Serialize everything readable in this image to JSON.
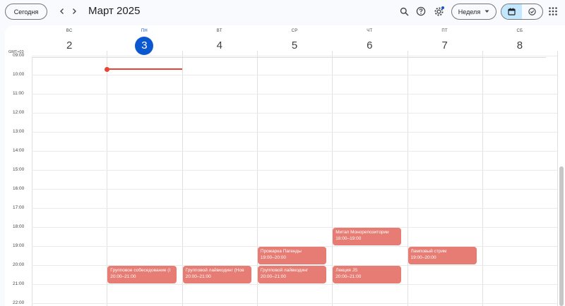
{
  "toolbar": {
    "today_label": "Сегодня",
    "prev_icon": "chevron-left-icon",
    "next_icon": "chevron-right-icon",
    "title": "Март 2025",
    "view_label": "Неделя",
    "accent": "#0b57d0"
  },
  "calendar": {
    "timezone": "GMT+03",
    "days": [
      {
        "dow": "ВС",
        "num": "2"
      },
      {
        "dow": "ПН",
        "num": "3",
        "today": true
      },
      {
        "dow": "ВТ",
        "num": "4"
      },
      {
        "dow": "СР",
        "num": "5"
      },
      {
        "dow": "ЧТ",
        "num": "6"
      },
      {
        "dow": "ПТ",
        "num": "7"
      },
      {
        "dow": "СБ",
        "num": "8"
      }
    ],
    "hours": [
      "09:00",
      "10:00",
      "11:00",
      "12:00",
      "13:00",
      "14:00",
      "15:00",
      "16:00",
      "17:00",
      "18:00",
      "19:00",
      "20:00",
      "21:00",
      "22:00"
    ],
    "events": [
      {
        "day": 1,
        "title": "Групповое собеседование (I",
        "time": "20:00–21:00"
      },
      {
        "day": 2,
        "title": "Групповой лайвкодинг (Нов",
        "time": "20:00–21:00"
      },
      {
        "day": 3,
        "title": "Прожарка Пагенды",
        "time": "19:00–20:00"
      },
      {
        "day": 3,
        "title": "Групповой лайвкодинг",
        "time": "20:00–21:00"
      },
      {
        "day": 4,
        "title": "Митап Монорепозитории",
        "time": "18:00–19:00"
      },
      {
        "day": 4,
        "title": "Лекция JS",
        "time": "20:00–21:00"
      },
      {
        "day": 5,
        "title": "Ламповый стрим",
        "time": "19:00–20:00"
      }
    ],
    "event_color": "#e67c73",
    "now_color": "#ea4335"
  }
}
